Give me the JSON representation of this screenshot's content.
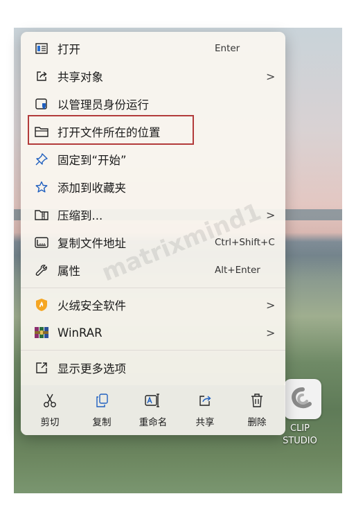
{
  "menu": {
    "items": [
      {
        "label": "打开",
        "shortcut": "Enter",
        "arrow": "",
        "icon": "open-window-icon"
      },
      {
        "label": "共享对象",
        "shortcut": "",
        "arrow": ">",
        "icon": "share-icon"
      },
      {
        "label": "以管理员身份运行",
        "shortcut": "",
        "arrow": "",
        "icon": "admin-shield-icon"
      },
      {
        "label": "打开文件所在的位置",
        "shortcut": "",
        "arrow": "",
        "icon": "folder-icon"
      },
      {
        "label": "固定到“开始”",
        "shortcut": "",
        "arrow": "",
        "icon": "pin-icon"
      },
      {
        "label": "添加到收藏夹",
        "shortcut": "",
        "arrow": "",
        "icon": "star-icon"
      },
      {
        "label": "压缩到...",
        "shortcut": "",
        "arrow": ">",
        "icon": "zip-icon"
      },
      {
        "label": "复制文件地址",
        "shortcut": "Ctrl+Shift+C",
        "arrow": "",
        "icon": "copy-path-icon"
      },
      {
        "label": "属性",
        "shortcut": "Alt+Enter",
        "arrow": "",
        "icon": "wrench-icon"
      },
      {
        "label": "火绒安全软件",
        "shortcut": "",
        "arrow": ">",
        "icon": "huorong-icon"
      },
      {
        "label": "WinRAR",
        "shortcut": "",
        "arrow": ">",
        "icon": "winrar-icon"
      },
      {
        "label": "显示更多选项",
        "shortcut": "",
        "arrow": "",
        "icon": "show-more-icon"
      }
    ],
    "actions": [
      {
        "label": "剪切",
        "icon": "scissors-icon"
      },
      {
        "label": "复制",
        "icon": "copy-icon"
      },
      {
        "label": "重命名",
        "icon": "rename-icon"
      },
      {
        "label": "共享",
        "icon": "share-icon"
      },
      {
        "label": "删除",
        "icon": "trash-icon"
      }
    ]
  },
  "desktop": {
    "app_icon_label_line1": "CLIP",
    "app_icon_label_line2": "STUDIO"
  },
  "watermark": "matrixmind1",
  "colors": {
    "highlight_border": "#b23a3a",
    "accent_blue": "#1f5fbf"
  }
}
